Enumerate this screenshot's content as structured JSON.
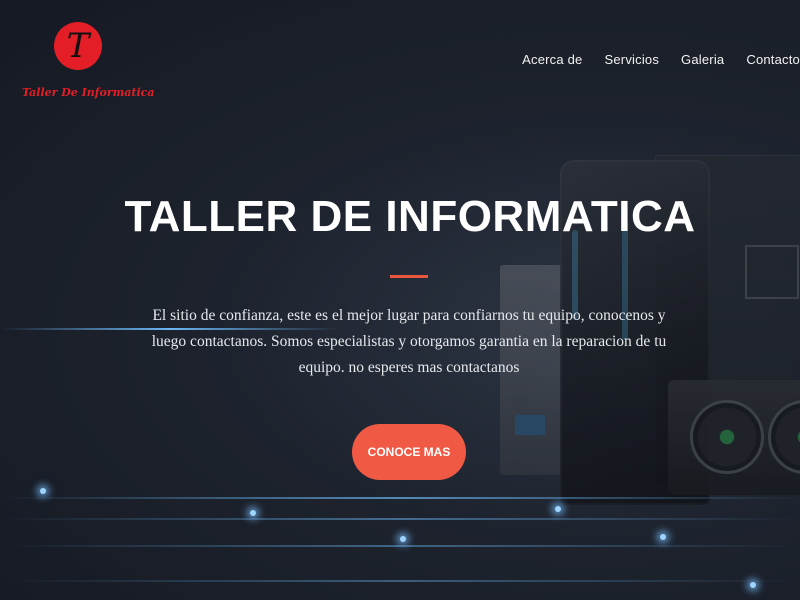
{
  "brand": {
    "logo_letter": "T",
    "name": "Taller De Informatica",
    "color": "#e41e27"
  },
  "nav": {
    "items": [
      {
        "label": "Acerca de"
      },
      {
        "label": "Servicios"
      },
      {
        "label": "Galeria"
      },
      {
        "label": "Contacto"
      }
    ]
  },
  "hero": {
    "title": "TALLER DE INFORMATICA",
    "description": "El sitio de confianza, este es el mejor lugar para confiarnos tu equipo, conocenos y luego contactanos. Somos especialistas y otorgamos garantia en la reparacion de tu equipo. no esperes mas contactanos",
    "cta_label": "CONOCE MAS",
    "accent_color": "#f05a45"
  }
}
